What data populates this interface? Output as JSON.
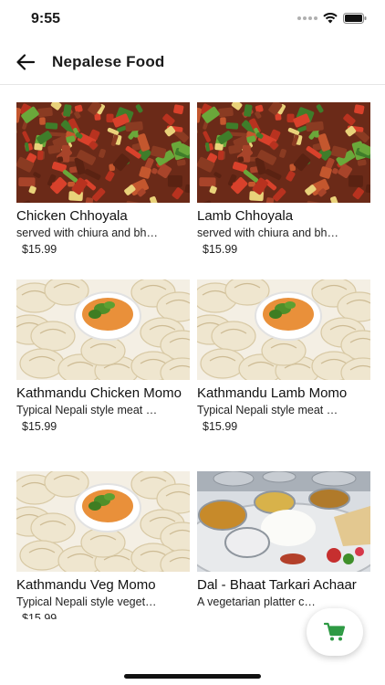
{
  "status_bar": {
    "time": "9:55"
  },
  "header": {
    "title": "Nepalese Food"
  },
  "products": [
    {
      "name": "Chicken Chhoyala",
      "description": "served with chiura and bh…",
      "price": "$15.99",
      "image": "chhoyala"
    },
    {
      "name": "Lamb Chhoyala",
      "description": "served with chiura and bh…",
      "price": "$15.99",
      "image": "chhoyala"
    },
    {
      "name": "Kathmandu Chicken Momo",
      "description": "Typical Nepali style meat …",
      "price": "$15.99",
      "image": "momo"
    },
    {
      "name": "Kathmandu Lamb Momo",
      "description": "Typical Nepali style meat …",
      "price": "$15.99",
      "image": "momo"
    },
    {
      "name": "Kathmandu Veg Momo",
      "description": "Typical Nepali style veget…",
      "price": "$15.99",
      "image": "momo"
    },
    {
      "name": "Dal - Bhaat Tarkari Achaar",
      "description": "A vegetarian platter c…",
      "price": "",
      "image": "thali"
    }
  ],
  "cart": {
    "icon": "shopping-cart-icon",
    "color": "#2e9a44"
  }
}
